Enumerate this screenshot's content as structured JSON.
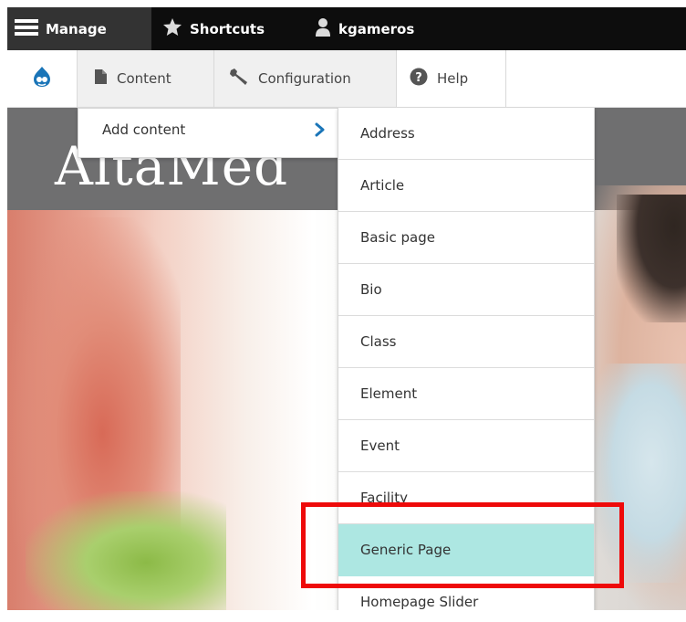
{
  "toolbar": {
    "manage_label": "Manage",
    "shortcuts_label": "Shortcuts",
    "user_label": "kgameros"
  },
  "tray": {
    "home_icon": "drupal-drop-icon",
    "content_label": "Content",
    "configuration_label": "Configuration",
    "help_label": "Help"
  },
  "background": {
    "logo_text": "AltaMed"
  },
  "menu": {
    "add_content_label": "Add content",
    "items": [
      {
        "label": "Address"
      },
      {
        "label": "Article"
      },
      {
        "label": "Basic page"
      },
      {
        "label": "Bio"
      },
      {
        "label": "Class"
      },
      {
        "label": "Element"
      },
      {
        "label": "Event"
      },
      {
        "label": "Facility"
      },
      {
        "label": "Generic Page"
      },
      {
        "label": "Homepage Slider"
      }
    ]
  },
  "colors": {
    "highlight": "#ee0a0a",
    "active_row": "#ade7e2",
    "accent_arrow": "#1a75b8"
  }
}
